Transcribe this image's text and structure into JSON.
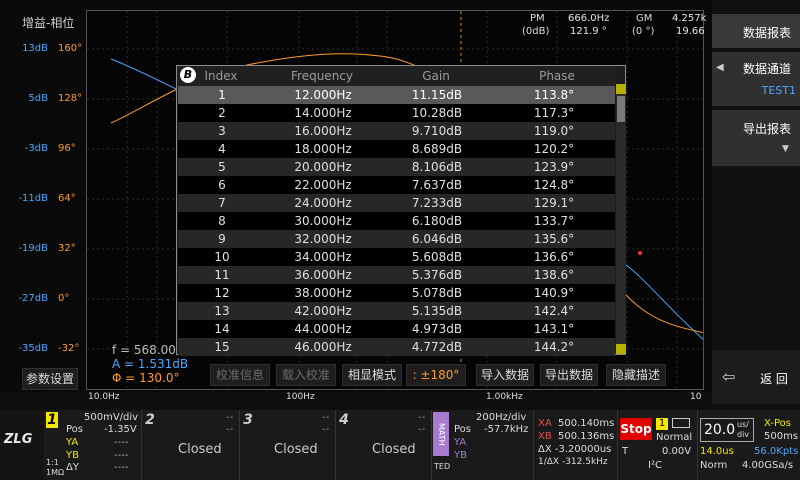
{
  "plot": {
    "title": "增益-相位",
    "gain_ticks": [
      "13dB",
      "5dB",
      "-3dB",
      "-11dB",
      "-19dB",
      "-27dB",
      "-35dB"
    ],
    "phase_ticks": [
      "160°",
      "128°",
      "96°",
      "64°",
      "32°",
      "0°",
      "-32°"
    ],
    "x_ticks": [
      "10.0Hz",
      "100Hz",
      "1.00kHz",
      "10"
    ],
    "pm_label": "PM",
    "pm_unit": "(0dB)",
    "pm_freq": "666.0Hz",
    "pm_value": "121.9 °",
    "gm_label": "GM",
    "gm_unit": "(0 °)",
    "gm_freq": "4.257k",
    "gm_value": "19.66"
  },
  "table": {
    "headers": [
      "Index",
      "Frequency",
      "Gain",
      "Phase"
    ],
    "rows": [
      [
        "1",
        "12.000Hz",
        "11.15dB",
        "113.8°"
      ],
      [
        "2",
        "14.000Hz",
        "10.28dB",
        "117.3°"
      ],
      [
        "3",
        "16.000Hz",
        "9.710dB",
        "119.0°"
      ],
      [
        "4",
        "18.000Hz",
        "8.689dB",
        "120.2°"
      ],
      [
        "5",
        "20.000Hz",
        "8.106dB",
        "123.9°"
      ],
      [
        "6",
        "22.000Hz",
        "7.637dB",
        "124.8°"
      ],
      [
        "7",
        "24.000Hz",
        "7.233dB",
        "129.1°"
      ],
      [
        "8",
        "30.000Hz",
        "6.180dB",
        "133.7°"
      ],
      [
        "9",
        "32.000Hz",
        "6.046dB",
        "135.6°"
      ],
      [
        "10",
        "34.000Hz",
        "5.608dB",
        "136.6°"
      ],
      [
        "11",
        "36.000Hz",
        "5.376dB",
        "138.6°"
      ],
      [
        "12",
        "38.000Hz",
        "5.078dB",
        "140.9°"
      ],
      [
        "13",
        "42.000Hz",
        "5.135dB",
        "142.4°"
      ],
      [
        "14",
        "44.000Hz",
        "4.973dB",
        "143.1°"
      ],
      [
        "15",
        "46.000Hz",
        "4.772dB",
        "144.2°"
      ]
    ],
    "badge": "B"
  },
  "readout": {
    "f": "f = 568.00",
    "a": "A = 1.531dB",
    "phi": "Φ = 130.0°"
  },
  "menu": {
    "params": "参数设置",
    "calib_info": "校准信息",
    "load_calib": "载入校准",
    "phase_mode": "相显模式",
    "phase_range": ": ±180°",
    "import": "导入数据",
    "export": "导出数据",
    "hide": "隐藏描述"
  },
  "right": {
    "report": "数据报表",
    "channel": "数据通道",
    "channel_value": "TEST1",
    "export_report": "导出报表",
    "back": "返 回"
  },
  "status": {
    "ch1_vdiv": "500mV/div",
    "ch1_pos_label": "Pos",
    "ch1_pos": "-1.35V",
    "ya": "YA",
    "yb": "YB",
    "dy": "ΔY",
    "dash4": "----",
    "coupling": "1:1",
    "impedance": "1MΩ",
    "ch2": "2",
    "ch3": "3",
    "ch4": "4",
    "closed": "Closed",
    "dd": "--",
    "math": "MATH",
    "math_div": "200Hz/div",
    "math_pos": "-57.7kHz",
    "ted": "TED",
    "xa_label": "XA",
    "xa": "500.140ms",
    "xb_label": "XB",
    "xb": "500.136ms",
    "dx": "ΔX -3.20000us",
    "inv_dx": "1/ΔX  -312.5kHz",
    "stop": "Stop",
    "trig_ch": "1",
    "normal": "Normal",
    "trig_t": "T",
    "trig_v": "0.00V",
    "i2c": "I²C",
    "timebase": "20.0",
    "tb_unit1": "us/",
    "tb_unit2": "div",
    "xpos_label": "X-Pos",
    "xpos": "500ms",
    "t14": "14.0us",
    "pts": "56.0Kpts",
    "norm": "Norm",
    "rate": "4.00GSa/s",
    "logo": "ZLG"
  },
  "colors": {
    "gain": "#4aa6ff",
    "phase": "#ff9a2a",
    "ch1": "#f5e800",
    "math": "#a97bd0",
    "stop": "#e00000"
  }
}
